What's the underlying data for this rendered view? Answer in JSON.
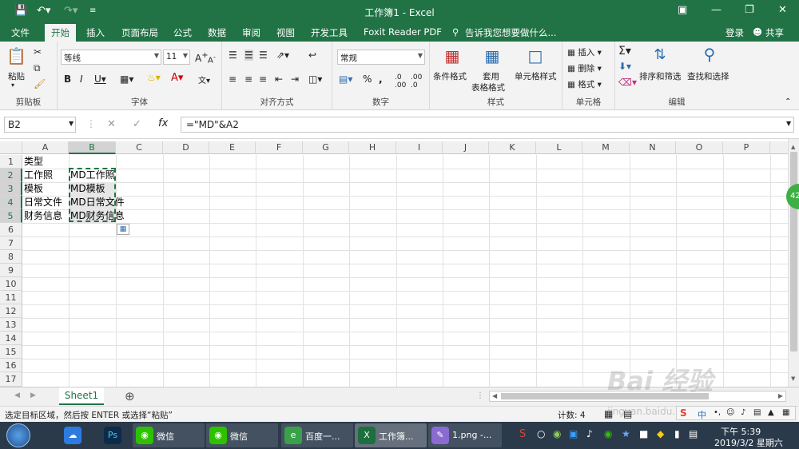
{
  "window": {
    "title": "工作簿1 - Excel",
    "quick_access": [
      "save-icon",
      "undo-icon",
      "redo-icon",
      "customize-icon"
    ]
  },
  "tabs": [
    "文件",
    "开始",
    "插入",
    "页面布局",
    "公式",
    "数据",
    "审阅",
    "视图",
    "开发工具",
    "Foxit Reader PDF"
  ],
  "active_tab": "开始",
  "tell_me": "告诉我您想要做什么...",
  "login": "登录",
  "share": "共享",
  "ribbon": {
    "clipboard": {
      "label": "剪贴板",
      "paste": "粘贴"
    },
    "font": {
      "label": "字体",
      "name": "等线",
      "size": "11"
    },
    "alignment": {
      "label": "对齐方式"
    },
    "number": {
      "label": "数字",
      "format": "常规"
    },
    "styles": {
      "label": "样式",
      "conditional": "条件格式",
      "table1": "套用",
      "table2": "表格格式",
      "cell_styles": "单元格样式"
    },
    "cells": {
      "label": "单元格",
      "insert": "插入",
      "delete": "删除",
      "format": "格式"
    },
    "editing": {
      "label": "编辑",
      "sort": "排序和筛选",
      "find": "查找和选择"
    }
  },
  "formula_bar": {
    "name_box": "B2",
    "formula": "=\"MD\"&A2"
  },
  "columns": [
    "A",
    "B",
    "C",
    "D",
    "E",
    "F",
    "G",
    "H",
    "I",
    "J",
    "K",
    "L",
    "M",
    "N",
    "O",
    "P"
  ],
  "selected_column": "B",
  "rows": [
    "1",
    "2",
    "3",
    "4",
    "5",
    "6",
    "7",
    "8",
    "9",
    "10",
    "11",
    "12",
    "13",
    "14",
    "15",
    "16",
    "17"
  ],
  "cells": {
    "A1": "类型",
    "A2": "工作照",
    "A3": "模板",
    "A4": "日常文件",
    "A5": "财务信息",
    "B2": "MD工作照",
    "B3": "MD模板",
    "B4": "MD日常文件",
    "B5": "MD财务信息"
  },
  "sheet": {
    "tab": "Sheet1"
  },
  "status": {
    "message": "选定目标区域，然后按 ENTER 或选择“粘贴”",
    "count": "计数: 4"
  },
  "taskbar": {
    "items": [
      "微信",
      "微信",
      "百度一...",
      "工作簿...",
      "1.png -..."
    ],
    "time": "下午 5:39",
    "date": "2019/3/2 星期六",
    "ime": "中"
  },
  "watermark": {
    "brand": "Bai 经验",
    "url": "jingyan.baidu.com"
  },
  "float_badge": "42"
}
